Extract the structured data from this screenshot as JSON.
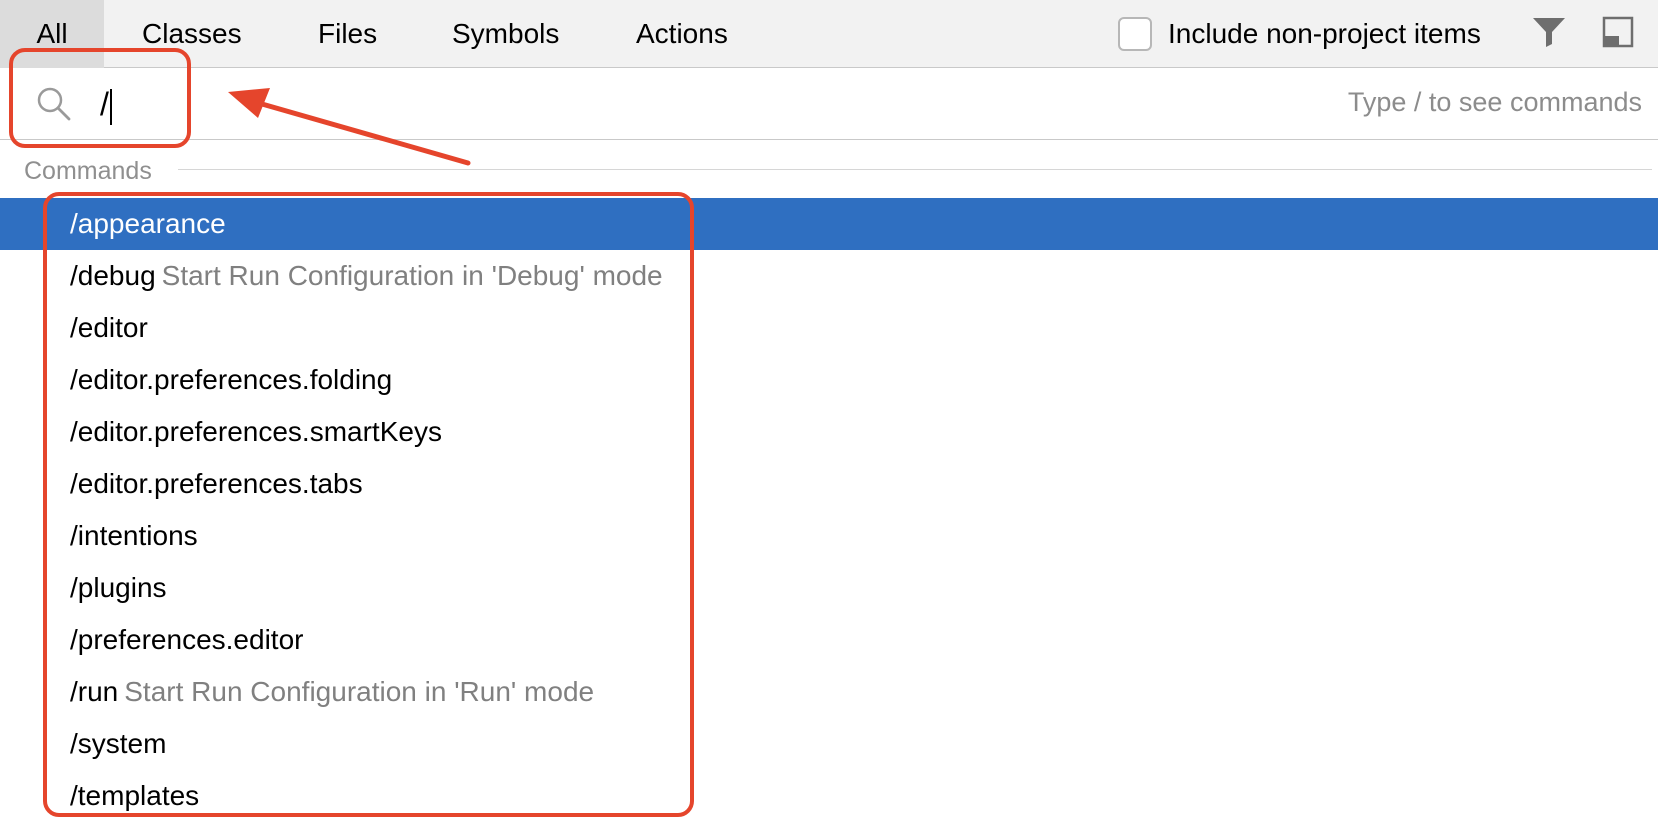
{
  "tabs": [
    {
      "label": "All",
      "active": true
    },
    {
      "label": "Classes"
    },
    {
      "label": "Files"
    },
    {
      "label": "Symbols"
    },
    {
      "label": "Actions"
    }
  ],
  "non_project": {
    "label": "Include non-project items",
    "checked": false
  },
  "icons": {
    "filter": "filter-icon",
    "layout": "layout-icon",
    "search": "search-icon"
  },
  "search": {
    "value": "/",
    "hint": "Type / to see commands"
  },
  "section": {
    "title": "Commands"
  },
  "commands": [
    {
      "name": "/appearance",
      "desc": "",
      "selected": true
    },
    {
      "name": "/debug",
      "desc": "Start Run Configuration in 'Debug' mode"
    },
    {
      "name": "/editor",
      "desc": ""
    },
    {
      "name": "/editor.preferences.folding",
      "desc": ""
    },
    {
      "name": "/editor.preferences.smartKeys",
      "desc": ""
    },
    {
      "name": "/editor.preferences.tabs",
      "desc": ""
    },
    {
      "name": "/intentions",
      "desc": ""
    },
    {
      "name": "/plugins",
      "desc": ""
    },
    {
      "name": "/preferences.editor",
      "desc": ""
    },
    {
      "name": "/run",
      "desc": "Start Run Configuration in 'Run' mode"
    },
    {
      "name": "/system",
      "desc": ""
    },
    {
      "name": "/templates",
      "desc": ""
    }
  ],
  "colors": {
    "selection": "#2f6fc1",
    "annotation": "#e5452c"
  }
}
